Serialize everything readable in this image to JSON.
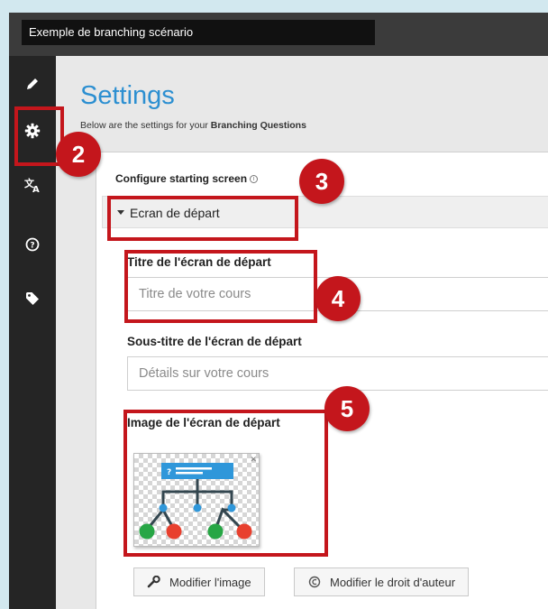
{
  "window": {
    "title": "Exemple de branching scénario"
  },
  "toolbar": {
    "items": [
      {
        "icon": "pencil-icon"
      },
      {
        "icon": "gear-icon"
      },
      {
        "icon": "translate-icon"
      },
      {
        "icon": "help-icon"
      },
      {
        "icon": "tag-icon"
      }
    ]
  },
  "settings": {
    "title": "Settings",
    "subtitle_prefix": "Below are the settings for your ",
    "subtitle_bold": "Branching Questions",
    "configure_label": "Configure starting screen",
    "group_label": "Ecran de départ",
    "fields": {
      "title_label": "Titre de l'écran de départ",
      "title_placeholder": "Titre de votre cours",
      "subtitle_label": "Sous-titre de l'écran de départ",
      "subtitle_placeholder": "Détails sur votre cours",
      "image_label": "Image de l'écran de départ"
    },
    "buttons": {
      "edit_image": "Modifier l'image",
      "edit_copyright": "Modifier le droit d'auteur"
    }
  },
  "annotations": [
    "2",
    "3",
    "4",
    "5"
  ],
  "colors": {
    "highlight": "#c4161c",
    "title": "#2c8fd1",
    "sidebar": "#252525"
  }
}
